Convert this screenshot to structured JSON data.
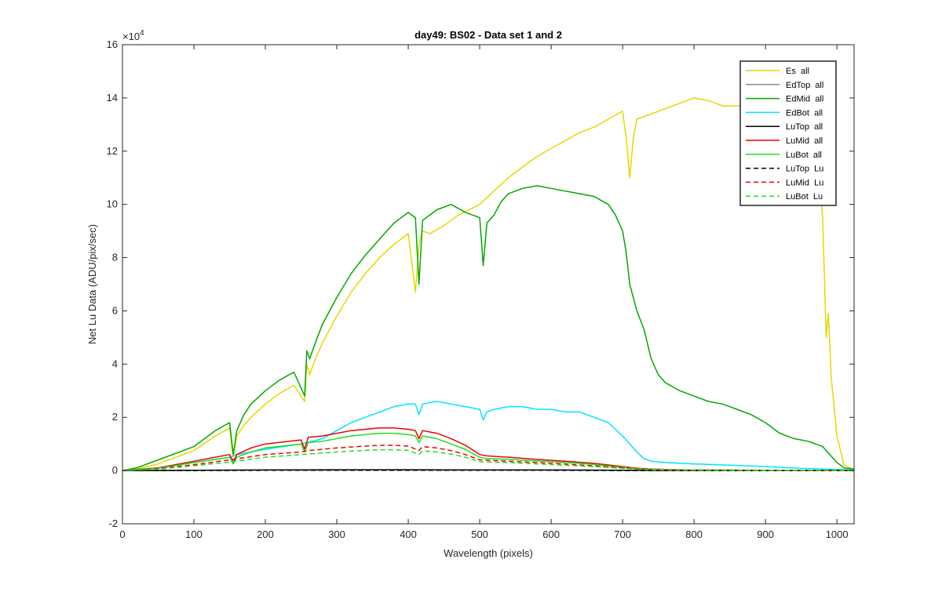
{
  "chart_data": {
    "type": "line",
    "title": "day49: BS02 - Data set 1 and 2",
    "xlabel": "Wavelength (pixels)",
    "ylabel": "Net Lu Data (ADU/pix/sec)",
    "exponent_label": "×10",
    "exponent_power": "4",
    "xlim": [
      0,
      1024
    ],
    "ylim": [
      -2,
      16
    ],
    "y_multiplier": 10000,
    "xticks": [
      0,
      100,
      200,
      300,
      400,
      500,
      600,
      700,
      800,
      900,
      1000
    ],
    "yticks": [
      -2,
      0,
      2,
      4,
      6,
      8,
      10,
      12,
      14,
      16
    ],
    "grid": false,
    "legend_position": "top-right",
    "series": [
      {
        "name": "Es  all",
        "color": "#e6d800",
        "dash": "solid",
        "x": [
          0,
          20,
          50,
          100,
          130,
          150,
          155,
          160,
          170,
          180,
          200,
          220,
          240,
          255,
          258,
          262,
          270,
          280,
          300,
          320,
          340,
          360,
          380,
          400,
          410,
          415,
          420,
          430,
          450,
          470,
          500,
          520,
          540,
          560,
          580,
          600,
          620,
          640,
          660,
          680,
          700,
          705,
          710,
          715,
          720,
          740,
          760,
          780,
          800,
          820,
          840,
          860,
          880,
          900,
          920,
          940,
          960,
          970,
          980,
          985,
          988,
          992,
          1000,
          1010,
          1024
        ],
        "y": [
          0,
          0.05,
          0.25,
          0.75,
          1.3,
          1.6,
          0.5,
          1.3,
          1.7,
          2.0,
          2.5,
          2.9,
          3.2,
          2.6,
          4.0,
          3.6,
          4.2,
          4.8,
          5.8,
          6.7,
          7.4,
          8.0,
          8.5,
          8.9,
          6.7,
          8.5,
          9.0,
          8.9,
          9.2,
          9.6,
          10.0,
          10.5,
          11.0,
          11.4,
          11.8,
          12.1,
          12.4,
          12.7,
          12.9,
          13.2,
          13.5,
          12.5,
          11.0,
          12.5,
          13.2,
          13.4,
          13.6,
          13.8,
          14.0,
          13.9,
          13.7,
          13.7,
          13.8,
          13.7,
          13.6,
          13.5,
          13.4,
          12.6,
          9.5,
          5.0,
          5.9,
          3.5,
          1.3,
          0.2,
          0.05
        ]
      },
      {
        "name": "EdTop  all",
        "color": "#8c8c8c",
        "dash": "solid",
        "x": [
          0,
          100,
          200,
          300,
          400,
          500,
          600,
          700,
          800,
          900,
          1000,
          1024
        ],
        "y": [
          0,
          0.01,
          0.02,
          0.02,
          0.03,
          0.02,
          0.02,
          0.01,
          0.0,
          0.0,
          0.0,
          0.0
        ]
      },
      {
        "name": "EdMid  all",
        "color": "#00a800",
        "dash": "solid",
        "x": [
          0,
          20,
          50,
          100,
          130,
          150,
          155,
          160,
          170,
          180,
          200,
          220,
          240,
          255,
          258,
          262,
          270,
          280,
          300,
          320,
          340,
          360,
          380,
          400,
          410,
          415,
          420,
          440,
          460,
          480,
          500,
          505,
          510,
          520,
          530,
          540,
          560,
          580,
          600,
          620,
          640,
          660,
          680,
          690,
          700,
          705,
          710,
          715,
          720,
          730,
          740,
          750,
          760,
          780,
          800,
          820,
          840,
          860,
          880,
          900,
          920,
          940,
          960,
          980,
          990,
          1000,
          1010,
          1024
        ],
        "y": [
          0,
          0.1,
          0.4,
          0.9,
          1.5,
          1.8,
          0.6,
          1.5,
          2.1,
          2.5,
          3.0,
          3.4,
          3.7,
          2.8,
          4.5,
          4.2,
          4.8,
          5.5,
          6.5,
          7.4,
          8.1,
          8.7,
          9.3,
          9.7,
          9.5,
          7.0,
          9.4,
          9.8,
          10.0,
          9.7,
          9.5,
          7.7,
          9.3,
          9.6,
          10.1,
          10.4,
          10.6,
          10.7,
          10.6,
          10.5,
          10.4,
          10.3,
          10.0,
          9.6,
          9.0,
          8.2,
          7.0,
          6.5,
          6.0,
          5.3,
          4.2,
          3.6,
          3.3,
          3.0,
          2.8,
          2.6,
          2.5,
          2.3,
          2.1,
          1.8,
          1.4,
          1.2,
          1.1,
          0.9,
          0.6,
          0.3,
          0.1,
          0.05
        ]
      },
      {
        "name": "EdBot  all",
        "color": "#00e5ff",
        "dash": "solid",
        "x": [
          0,
          50,
          100,
          150,
          160,
          200,
          250,
          280,
          300,
          320,
          340,
          360,
          380,
          400,
          410,
          415,
          420,
          440,
          460,
          480,
          500,
          505,
          510,
          520,
          540,
          560,
          580,
          600,
          620,
          640,
          660,
          680,
          700,
          720,
          730,
          740,
          760,
          800,
          850,
          900,
          950,
          1000,
          1024
        ],
        "y": [
          0,
          0.1,
          0.3,
          0.5,
          0.6,
          0.8,
          1.0,
          1.2,
          1.5,
          1.8,
          2.0,
          2.2,
          2.4,
          2.5,
          2.5,
          2.1,
          2.5,
          2.6,
          2.5,
          2.4,
          2.3,
          1.9,
          2.2,
          2.3,
          2.4,
          2.4,
          2.3,
          2.3,
          2.2,
          2.2,
          2.0,
          1.8,
          1.3,
          0.7,
          0.45,
          0.35,
          0.3,
          0.25,
          0.2,
          0.15,
          0.08,
          0.04,
          0.02
        ]
      },
      {
        "name": "LuTop  all",
        "color": "#000000",
        "dash": "solid",
        "x": [
          0,
          100,
          200,
          300,
          400,
          500,
          600,
          700,
          800,
          900,
          1000,
          1024
        ],
        "y": [
          0,
          0.01,
          0.02,
          0.03,
          0.03,
          0.02,
          0.02,
          0.01,
          0.0,
          0.0,
          0.0,
          0.0
        ]
      },
      {
        "name": "LuMid  all",
        "color": "#ee0000",
        "dash": "solid",
        "x": [
          0,
          50,
          100,
          150,
          155,
          160,
          180,
          200,
          250,
          255,
          260,
          280,
          300,
          320,
          340,
          360,
          380,
          400,
          410,
          415,
          420,
          440,
          460,
          480,
          500,
          510,
          540,
          580,
          620,
          660,
          700,
          720,
          740,
          760,
          800,
          900,
          1000,
          1024
        ],
        "y": [
          0,
          0.1,
          0.35,
          0.6,
          0.3,
          0.6,
          0.85,
          1.0,
          1.15,
          0.8,
          1.25,
          1.3,
          1.4,
          1.5,
          1.55,
          1.6,
          1.6,
          1.55,
          1.5,
          1.2,
          1.5,
          1.4,
          1.2,
          0.95,
          0.6,
          0.55,
          0.5,
          0.42,
          0.35,
          0.27,
          0.15,
          0.09,
          0.06,
          0.04,
          0.02,
          0.01,
          0.0,
          0.0
        ]
      },
      {
        "name": "LuBot  all",
        "color": "#22dd22",
        "dash": "solid",
        "x": [
          0,
          50,
          100,
          150,
          155,
          160,
          180,
          200,
          250,
          255,
          260,
          280,
          300,
          320,
          340,
          360,
          380,
          400,
          410,
          415,
          420,
          440,
          460,
          480,
          500,
          510,
          540,
          580,
          620,
          660,
          700,
          720,
          740,
          760,
          800,
          900,
          1000,
          1024
        ],
        "y": [
          0,
          0.08,
          0.3,
          0.5,
          0.25,
          0.5,
          0.7,
          0.85,
          1.0,
          0.7,
          1.05,
          1.1,
          1.2,
          1.3,
          1.35,
          1.4,
          1.4,
          1.35,
          1.3,
          1.05,
          1.3,
          1.2,
          1.0,
          0.8,
          0.5,
          0.45,
          0.42,
          0.36,
          0.3,
          0.23,
          0.12,
          0.07,
          0.05,
          0.03,
          0.02,
          0.01,
          0.0,
          0.0
        ]
      },
      {
        "name": "LuTop  Lu",
        "color": "#000000",
        "dash": "dash",
        "x": [
          0,
          100,
          200,
          300,
          400,
          500,
          600,
          700,
          800,
          900,
          1000,
          1024
        ],
        "y": [
          0,
          0.0,
          0.01,
          0.01,
          0.01,
          0.01,
          0.01,
          0.0,
          0.0,
          0.0,
          0.0,
          0.0
        ]
      },
      {
        "name": "LuMid  Lu",
        "color": "#ee0000",
        "dash": "dash",
        "x": [
          0,
          50,
          100,
          150,
          200,
          250,
          260,
          300,
          340,
          360,
          380,
          400,
          415,
          420,
          440,
          460,
          480,
          500,
          540,
          580,
          620,
          660,
          700,
          740,
          800,
          900,
          1024
        ],
        "y": [
          0,
          0.07,
          0.22,
          0.4,
          0.6,
          0.7,
          0.75,
          0.85,
          0.92,
          0.95,
          0.95,
          0.92,
          0.75,
          0.9,
          0.85,
          0.75,
          0.6,
          0.4,
          0.35,
          0.3,
          0.24,
          0.18,
          0.1,
          0.04,
          0.01,
          0.0,
          0.0
        ]
      },
      {
        "name": "LuBot  Lu",
        "color": "#22dd22",
        "dash": "dash",
        "x": [
          0,
          50,
          100,
          150,
          200,
          250,
          260,
          300,
          340,
          360,
          380,
          400,
          415,
          420,
          440,
          460,
          480,
          500,
          540,
          580,
          620,
          660,
          700,
          740,
          800,
          900,
          1024
        ],
        "y": [
          0,
          0.05,
          0.18,
          0.32,
          0.5,
          0.6,
          0.62,
          0.7,
          0.76,
          0.78,
          0.78,
          0.76,
          0.6,
          0.74,
          0.7,
          0.62,
          0.5,
          0.33,
          0.3,
          0.25,
          0.2,
          0.15,
          0.08,
          0.03,
          0.01,
          0.0,
          0.0
        ]
      }
    ]
  }
}
